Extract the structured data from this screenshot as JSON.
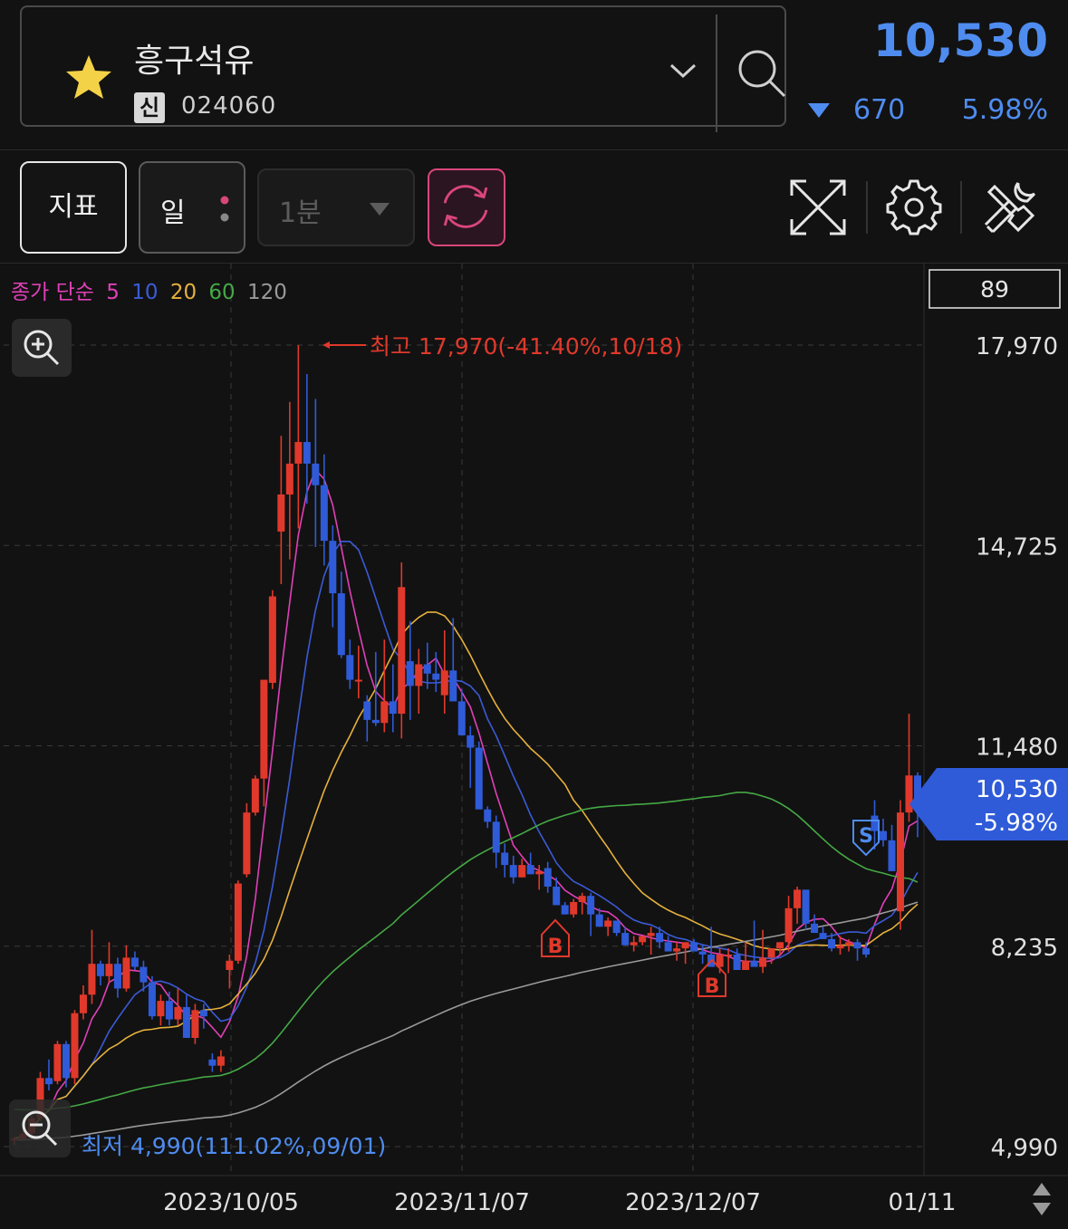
{
  "header": {
    "stock_name": "흥구석유",
    "market_badge": "신",
    "stock_code": "024060",
    "price": "10,530",
    "change": "670",
    "change_pct": "5.98%",
    "change_direction": "down",
    "favorite_icon": "star-icon",
    "dropdown_icon": "chevron-down-icon",
    "search_icon": "search-icon"
  },
  "toolbar": {
    "indicator_label": "지표",
    "period_label": "일",
    "interval_label": "1분",
    "refresh_icon": "refresh-icon",
    "fullscreen_icon": "expand-icon",
    "settings_icon": "gear-icon",
    "tools_icon": "tools-icon"
  },
  "legend": {
    "prefix": "종가 단순",
    "ma": [
      {
        "label": "5",
        "color": "#e040b8"
      },
      {
        "label": "10",
        "color": "#3b5bd6"
      },
      {
        "label": "20",
        "color": "#e6b13c"
      },
      {
        "label": "60",
        "color": "#45a845"
      },
      {
        "label": "120",
        "color": "#9a9a9a"
      }
    ]
  },
  "overlay": {
    "top_box": "89",
    "high_label": "최고 17,970(-41.40%,10/18)",
    "low_label": "최저 4,990(111.02%,09/01)",
    "current_price": "10,530",
    "current_pct": "-5.98%",
    "markers": [
      "B",
      "B",
      "S"
    ],
    "zoom_in_icon": "zoom-in-icon",
    "zoom_out_icon": "zoom-out-icon",
    "scroll_icon": "scroll-arrows-icon"
  },
  "colors": {
    "up": "#e0392b",
    "down": "#2f5bd8",
    "accent_blue": "#4f8cf0",
    "refresh_border": "#d9467a"
  },
  "chart_data": {
    "type": "candlestick",
    "y_axis_labels": [
      "17,970",
      "14,725",
      "11,480",
      "8,235",
      "4,990"
    ],
    "x_axis_labels": [
      "2023/10/05",
      "2023/11/07",
      "2023/12/07",
      "01/11"
    ],
    "ylim": [
      4990,
      17970
    ],
    "grid": true,
    "series": [
      {
        "name": "5"
      },
      {
        "name": "10"
      },
      {
        "name": "20"
      },
      {
        "name": "60"
      },
      {
        "name": "120"
      }
    ],
    "candles": [
      [
        5100,
        5150,
        5020,
        5120
      ],
      [
        5120,
        5250,
        5080,
        5200
      ],
      [
        5200,
        5500,
        5150,
        5450
      ],
      [
        5450,
        6200,
        5400,
        6100
      ],
      [
        6100,
        6400,
        5900,
        6000
      ],
      [
        6050,
        6700,
        6000,
        6650
      ],
      [
        6650,
        6700,
        5950,
        6100
      ],
      [
        6100,
        7200,
        6000,
        7150
      ],
      [
        7150,
        7600,
        7050,
        7450
      ],
      [
        7450,
        8500,
        7300,
        7950
      ],
      [
        7950,
        8000,
        7600,
        7750
      ],
      [
        7750,
        8300,
        7650,
        7950
      ],
      [
        7950,
        8050,
        7400,
        7550
      ],
      [
        7550,
        8250,
        7500,
        8050
      ],
      [
        8050,
        8150,
        7850,
        7900
      ],
      [
        7900,
        8000,
        7500,
        7650
      ],
      [
        7650,
        7750,
        7050,
        7100
      ],
      [
        7100,
        7450,
        6950,
        7350
      ],
      [
        7350,
        7500,
        6950,
        7050
      ],
      [
        7050,
        7550,
        6950,
        7250
      ],
      [
        7250,
        7450,
        6750,
        6750
      ],
      [
        6750,
        7300,
        6650,
        7200
      ],
      [
        7200,
        7300,
        6900,
        7100
      ],
      [
        6400,
        6500,
        6200,
        6300
      ],
      [
        6300,
        6550,
        6200,
        6450
      ],
      [
        7850,
        8100,
        7550,
        8000
      ],
      [
        8000,
        9300,
        7950,
        9250
      ],
      [
        9400,
        10550,
        9350,
        10400
      ],
      [
        10400,
        11000,
        10350,
        10950
      ],
      [
        10950,
        12300,
        10500,
        12550
      ],
      [
        12500,
        14000,
        12400,
        13900
      ],
      [
        14950,
        16500,
        14100,
        15550
      ],
      [
        15550,
        17050,
        14500,
        16050
      ],
      [
        16050,
        17970,
        15000,
        16400
      ],
      [
        16400,
        17500,
        15400,
        16050
      ],
      [
        16050,
        17100,
        14700,
        15700
      ],
      [
        15700,
        16200,
        14400,
        14800
      ],
      [
        14800,
        15050,
        13400,
        13950
      ],
      [
        13950,
        14300,
        12900,
        12950
      ],
      [
        12950,
        13200,
        12400,
        12550
      ],
      [
        12550,
        13100,
        12250,
        12550
      ],
      [
        12200,
        12300,
        11550,
        11900
      ],
      [
        11900,
        13000,
        11800,
        11850
      ],
      [
        11850,
        13200,
        11700,
        12200
      ],
      [
        12200,
        12800,
        11700,
        12000
      ],
      [
        12000,
        14450,
        11600,
        14050
      ],
      [
        12850,
        13500,
        11900,
        12450
      ],
      [
        12450,
        13050,
        12000,
        12800
      ],
      [
        12800,
        13150,
        12400,
        12650
      ],
      [
        12650,
        13000,
        12350,
        12550
      ],
      [
        12300,
        13350,
        12000,
        12700
      ],
      [
        12700,
        13550,
        12200,
        12200
      ],
      [
        12200,
        12400,
        11750,
        11650
      ],
      [
        11650,
        11800,
        10800,
        11450
      ],
      [
        11450,
        11550,
        10550,
        10450
      ],
      [
        10450,
        10500,
        10150,
        10250
      ],
      [
        10250,
        10350,
        9500,
        9750
      ],
      [
        9750,
        9900,
        9350,
        9550
      ],
      [
        9550,
        9700,
        9250,
        9350
      ],
      [
        9350,
        9650,
        9350,
        9550
      ],
      [
        9550,
        9750,
        9400,
        9400
      ],
      [
        9400,
        9550,
        9150,
        9450
      ],
      [
        9500,
        9600,
        9100,
        9200
      ],
      [
        9200,
        9350,
        8900,
        8900
      ],
      [
        8900,
        8950,
        8750,
        8750
      ],
      [
        8750,
        9000,
        8700,
        8950
      ],
      [
        8950,
        9100,
        8750,
        9050
      ],
      [
        9050,
        9100,
        8400,
        8750
      ],
      [
        8750,
        8850,
        8550,
        8550
      ],
      [
        8550,
        8700,
        8400,
        8650
      ],
      [
        8650,
        8650,
        8400,
        8450
      ],
      [
        8450,
        8550,
        8250,
        8250
      ],
      [
        8250,
        8400,
        8150,
        8300
      ],
      [
        8300,
        8400,
        8250,
        8400
      ],
      [
        8400,
        8550,
        8100,
        8450
      ],
      [
        8450,
        8550,
        8200,
        8300
      ],
      [
        8300,
        8400,
        8150,
        8150
      ],
      [
        8150,
        8300,
        8000,
        8200
      ],
      [
        8200,
        8300,
        7950,
        8300
      ],
      [
        8300,
        8350,
        8200,
        8150
      ],
      [
        8150,
        8250,
        7950,
        8100
      ],
      [
        8100,
        8550,
        8000,
        7900
      ],
      [
        7900,
        8200,
        7800,
        8100
      ],
      [
        8100,
        8200,
        7800,
        8100
      ],
      [
        8100,
        8200,
        7950,
        7850
      ],
      [
        7850,
        8300,
        7950,
        8000
      ],
      [
        8000,
        8650,
        7950,
        7900
      ],
      [
        7900,
        8500,
        7800,
        8050
      ],
      [
        8050,
        8150,
        7950,
        8200
      ],
      [
        8200,
        8300,
        8100,
        8300
      ],
      [
        8300,
        9050,
        8150,
        8850
      ],
      [
        8850,
        9200,
        8600,
        9150
      ],
      [
        9150,
        9150,
        8500,
        8600
      ],
      [
        8600,
        8750,
        8500,
        8450
      ],
      [
        8450,
        8550,
        8350,
        8350
      ],
      [
        8350,
        8450,
        8150,
        8200
      ],
      [
        8200,
        8400,
        8100,
        8250
      ],
      [
        8250,
        8350,
        8150,
        8300
      ],
      [
        8300,
        8350,
        8000,
        8200
      ],
      [
        8200,
        8300,
        8050,
        8100
      ],
      [
        10350,
        10600,
        9800,
        10100
      ],
      [
        10100,
        10300,
        9850,
        9950
      ],
      [
        9950,
        10200,
        9450,
        9450
      ],
      [
        8800,
        10600,
        8500,
        10400
      ],
      [
        10400,
        12000,
        10250,
        11000
      ],
      [
        11000,
        11050,
        10000,
        10530
      ]
    ]
  }
}
